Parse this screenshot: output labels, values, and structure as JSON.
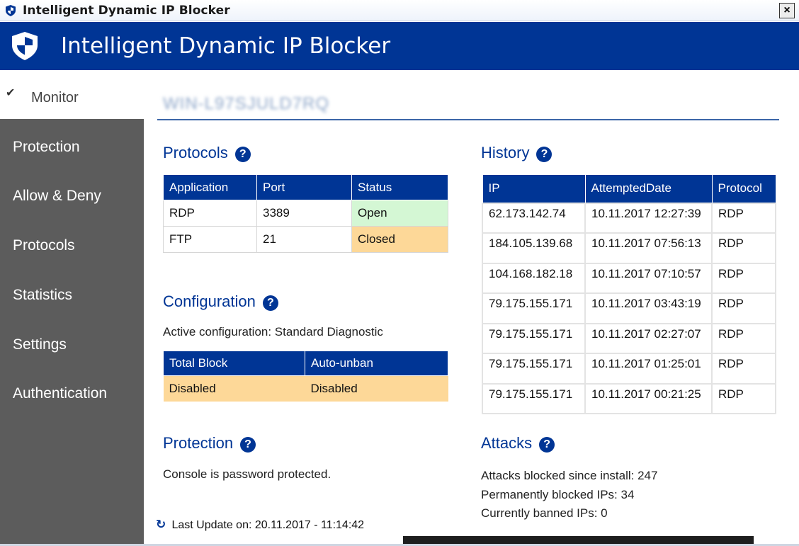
{
  "window": {
    "title": "Intelligent Dynamic IP Blocker",
    "close_label": "×",
    "icon": "shield-icon"
  },
  "header": {
    "title": "Intelligent Dynamic IP Blocker",
    "icon": "shield-icon"
  },
  "sidebar": {
    "active": {
      "check": "✔",
      "label": "Monitor"
    },
    "items": [
      {
        "label": "Protection"
      },
      {
        "label": "Allow & Deny"
      },
      {
        "label": "Protocols"
      },
      {
        "label": "Statistics"
      },
      {
        "label": "Settings"
      },
      {
        "label": "Authentication"
      }
    ]
  },
  "main": {
    "hostname": "WIN-L97SJULD7RQ",
    "help_glyph": "?",
    "protocols": {
      "title": "Protocols",
      "columns": [
        "Application",
        "Port",
        "Status"
      ],
      "rows": [
        {
          "app": "RDP",
          "port": "3389",
          "status": "Open"
        },
        {
          "app": "FTP",
          "port": "21",
          "status": "Closed"
        }
      ]
    },
    "configuration": {
      "title": "Configuration",
      "active_text": "Active configuration: Standard Diagnostic",
      "columns": [
        "Total Block",
        "Auto-unban"
      ],
      "values": [
        "Disabled",
        "Disabled"
      ]
    },
    "protection": {
      "title": "Protection",
      "text": "Console is password protected."
    },
    "history": {
      "title": "History",
      "columns": [
        "IP",
        "AttemptedDate",
        "Protocol"
      ],
      "rows": [
        [
          "62.173.142.74",
          "10.11.2017 12:27:39",
          "RDP"
        ],
        [
          "184.105.139.68",
          "10.11.2017 07:56:13",
          "RDP"
        ],
        [
          "104.168.182.18",
          "10.11.2017 07:10:57",
          "RDP"
        ],
        [
          "79.175.155.171",
          "10.11.2017 03:43:19",
          "RDP"
        ],
        [
          "79.175.155.171",
          "10.11.2017 02:27:07",
          "RDP"
        ],
        [
          "79.175.155.171",
          "10.11.2017 01:25:01",
          "RDP"
        ],
        [
          "79.175.155.171",
          "10.11.2017 00:21:25",
          "RDP"
        ]
      ]
    },
    "attacks": {
      "title": "Attacks",
      "lines": [
        "Attacks blocked since install: 247",
        "Permanently blocked IPs: 34",
        "Currently banned IPs: 0"
      ]
    },
    "last_update": "Last Update on: 20.11.2017 - 11:14:42"
  },
  "colors": {
    "brand": "#003595",
    "sidebar": "#5c5c5c",
    "status_open": "#d4f7d4",
    "status_closed": "#fdd898"
  }
}
